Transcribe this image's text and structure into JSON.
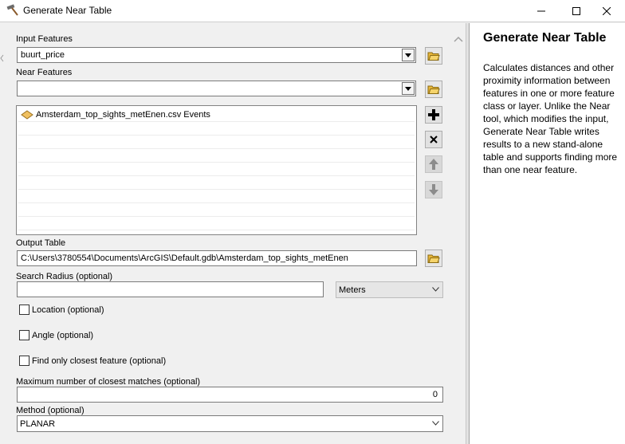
{
  "window": {
    "title": "Generate Near Table",
    "app_icon": "hammer-icon",
    "controls": [
      "minimize-icon",
      "maximize-icon",
      "close-icon"
    ]
  },
  "form": {
    "input_features": {
      "label": "Input Features",
      "value": "buurt_price"
    },
    "near_features": {
      "label": "Near Features",
      "value": "",
      "items": [
        "Amsterdam_top_sights_metEnen.csv Events"
      ],
      "buttons": [
        "add-icon",
        "remove-icon",
        "move-up-icon",
        "move-down-icon"
      ]
    },
    "output_table": {
      "label": "Output Table",
      "value": "C:\\Users\\3780554\\Documents\\ArcGIS\\Default.gdb\\Amsterdam_top_sights_metEnen"
    },
    "search_radius": {
      "label": "Search Radius (optional)",
      "value": "",
      "unit": "Meters"
    },
    "location": {
      "label": "Location (optional)",
      "checked": false
    },
    "angle": {
      "label": "Angle (optional)",
      "checked": false
    },
    "closest": {
      "label": "Find only closest feature (optional)",
      "checked": false
    },
    "max_matches": {
      "label": "Maximum number of closest matches (optional)",
      "value": "0"
    },
    "method": {
      "label": "Method (optional)",
      "value": "PLANAR"
    }
  },
  "help": {
    "title": "Generate Near Table",
    "text": "Calculates distances and other proximity information between features in one or more feature class or layer. Unlike the Near tool, which modifies the input, Generate Near Table writes results to a new stand-alone table and supports finding more than one near feature."
  }
}
